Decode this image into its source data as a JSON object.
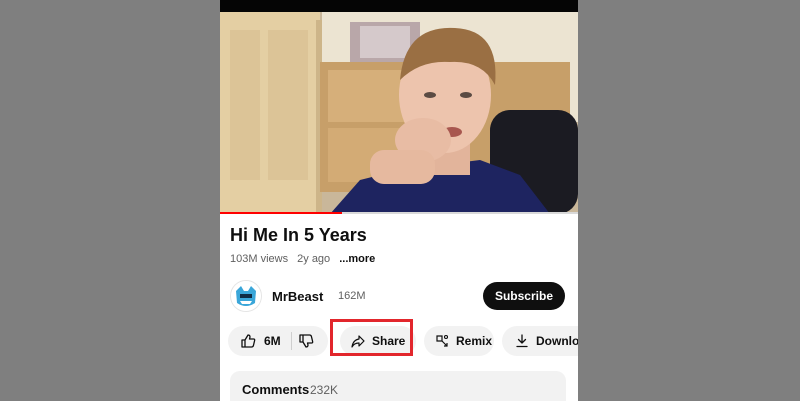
{
  "video": {
    "progress_percent": 34,
    "player_badge": "▪▪▪"
  },
  "title": "Hi Me In 5 Years",
  "meta": {
    "views": "103M views",
    "age": "2y ago",
    "more": "...more"
  },
  "channel": {
    "name": "MrBeast",
    "subscribers": "162M",
    "subscribe_label": "Subscribe"
  },
  "actions": {
    "like_count": "6M",
    "share_label": "Share",
    "remix_label": "Remix",
    "download_label": "Download"
  },
  "comments": {
    "header": "Comments",
    "count": "232K"
  },
  "colors": {
    "highlight": "#e2262c",
    "progress": "#ff0000",
    "avatar_brand": "#3aa6d9"
  }
}
